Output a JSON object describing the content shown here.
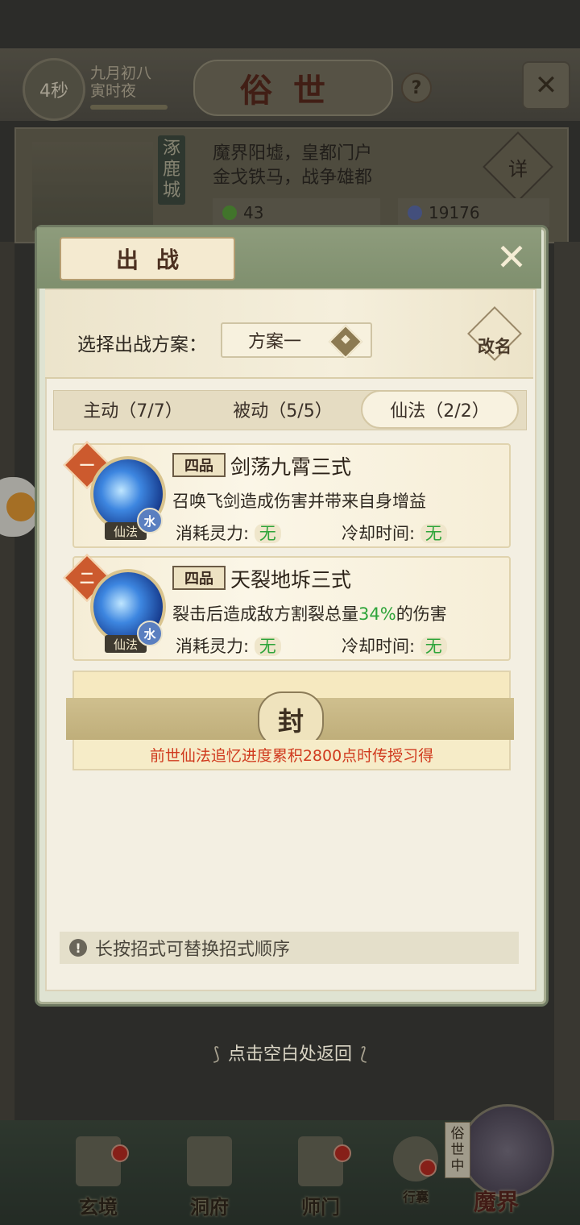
{
  "hud": {
    "timer": "4秒",
    "date_line1": "九月初八",
    "date_line2": "寅时夜",
    "title": "俗世",
    "help_icon": "question-icon",
    "close_icon": "close-x-icon"
  },
  "city": {
    "name": "涿鹿城",
    "desc_line1": "魔界阳墟，皇都门户",
    "desc_line2": "金戈铁马，战争雄都",
    "detail_label": "详",
    "resource1_value": "43",
    "resource2_value": "19176",
    "resource1_color": "#5aa83a",
    "resource2_color": "#5c6fb6"
  },
  "modal": {
    "title": "出战",
    "plan_label": "选择出战方案：",
    "plan_selected": "方案一",
    "rename_label": "改名",
    "tabs": [
      {
        "label": "主动（7/7）",
        "active": false
      },
      {
        "label": "被动（5/5）",
        "active": false
      },
      {
        "label": "仙法（2/2）",
        "active": true
      }
    ],
    "skills": [
      {
        "index": "一",
        "grade": "四品",
        "name": "剑荡九霄三式",
        "desc": "召唤飞剑造成伤害并带来自身增益",
        "type_tag": "仙法",
        "element": "水",
        "cost_label": "消耗灵力:",
        "cost_value": "无",
        "cooldown_label": "冷却时间:",
        "cooldown_value": "无"
      },
      {
        "index": "二",
        "grade": "四品",
        "name": "天裂地坼三式",
        "desc_prefix": "裂击后造成敌方割裂总量",
        "desc_highlight": "34%",
        "desc_suffix": "的伤害",
        "type_tag": "仙法",
        "element": "水",
        "cost_label": "消耗灵力:",
        "cost_value": "无",
        "cooldown_label": "冷却时间:",
        "cooldown_value": "无"
      }
    ],
    "sealed": {
      "seal_char": "封",
      "unlock_text": "前世仙法追忆进度累积2800点时传授习得"
    },
    "hint": "长按招式可替换招式顺序",
    "highlight_color": "#2ea43a",
    "warning_color": "#d03a1e"
  },
  "return_hint": "点击空白处返回",
  "nav": {
    "items": [
      {
        "label": "玄境",
        "badge": true
      },
      {
        "label": "洞府",
        "badge": false
      },
      {
        "label": "师门",
        "badge": true
      },
      {
        "label": "行囊",
        "badge": true
      }
    ],
    "realm_status": "俗世中",
    "realm_label": "魔界"
  }
}
